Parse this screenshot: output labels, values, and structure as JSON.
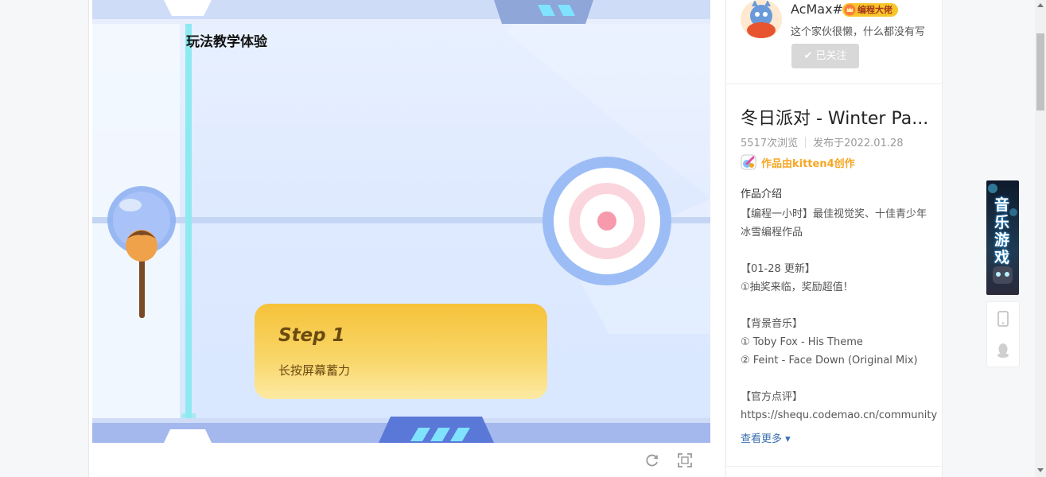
{
  "game": {
    "heading": "玩法教学体验",
    "step_title": "Step 1",
    "step_text": "长按屏幕蓄力"
  },
  "player_tools": {
    "icons": [
      "refresh-icon",
      "fullscreen-icon"
    ]
  },
  "author": {
    "name": "AcMax#",
    "badge": "编程大佬",
    "bio": "这个家伙很懒，什么都没有写",
    "follow_label": "✔ 已关注"
  },
  "work": {
    "title": "冬日派对 - Winter Pa...",
    "views": "5517次浏览",
    "published": "发布于2022.01.28",
    "made_with": "作品由kitten4创作",
    "intro_heading": "作品介绍",
    "description_lines": [
      "【编程一小时】最佳视觉奖、十佳青少年",
      "冰雪编程作品",
      "",
      "【01-28 更新】",
      "①抽奖来临，奖励超值！",
      "",
      "【背景音乐】",
      "① Toby Fox - His Theme",
      "② Feint - Face Down (Original Mix)",
      "",
      "【官方点评】",
      "https://shequ.codemao.cn/community"
    ],
    "see_more": "查看更多 ▾"
  },
  "float": {
    "banner_text": "音乐游戏",
    "icons": [
      "mobile-icon",
      "qq-icon"
    ]
  },
  "colors": {
    "badge": "#f6c62a",
    "kitten": "#f5a623",
    "link": "#3a6fb0",
    "step_card": "#f6c23a"
  }
}
